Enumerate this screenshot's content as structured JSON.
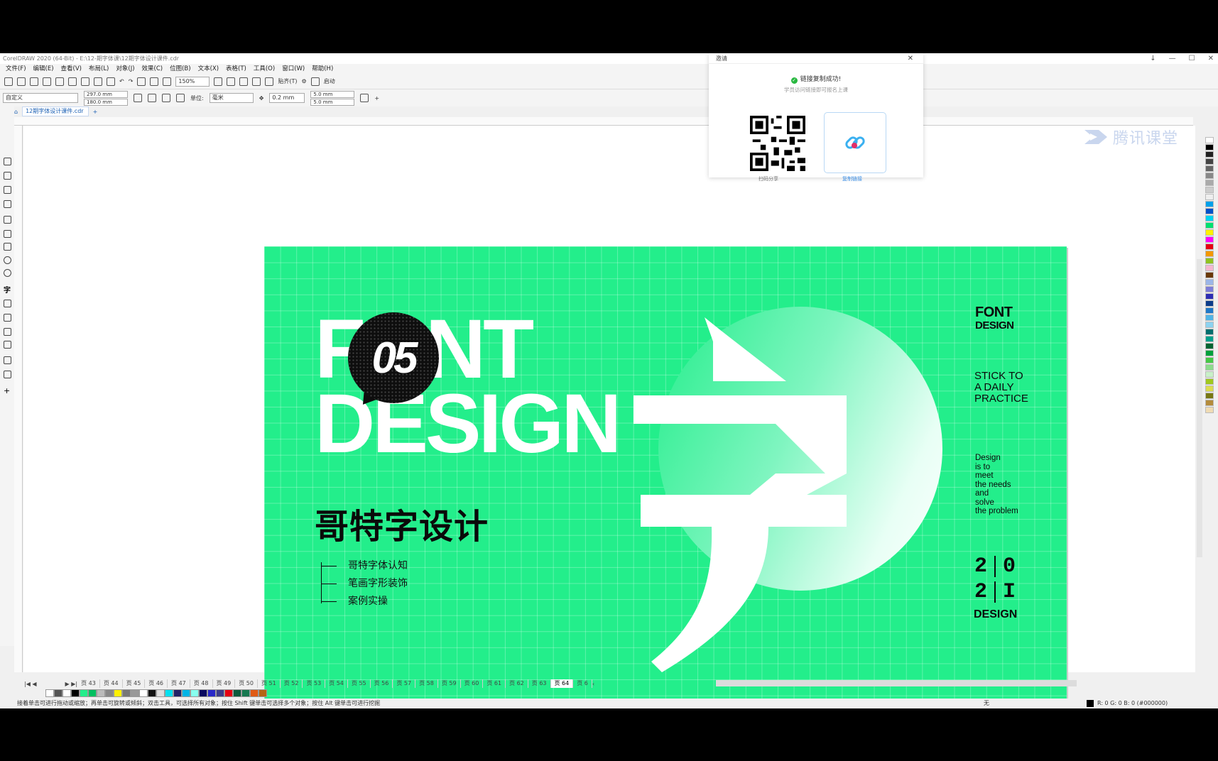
{
  "window": {
    "title": "CorelDRAW 2020 (64-Bit) - E:\\12-期字体课\\12期字体设计课件.cdr",
    "controls": [
      "↓",
      "—",
      "☐",
      "✕"
    ]
  },
  "menu": [
    "文件(F)",
    "编辑(E)",
    "查看(V)",
    "布局(L)",
    "对象(J)",
    "效果(C)",
    "位图(B)",
    "文本(X)",
    "表格(T)",
    "工具(O)",
    "窗口(W)",
    "帮助(H)"
  ],
  "toolbar": {
    "zoom": "150%",
    "snap_label": "贴齐(T)",
    "launch_label": "启动"
  },
  "property_bar": {
    "page_preset": "自定义",
    "width": "297.0 mm",
    "height": "180.0 mm",
    "unit_label": "单位:",
    "unit": "毫米",
    "nudge": "0.2 mm",
    "dup_x": "5.0 mm",
    "dup_y": "5.0 mm"
  },
  "document_tab": "12期字体设计课件.cdr",
  "artwork": {
    "font_word": "FONT",
    "design_word": "DESIGN",
    "badge_number": "05",
    "cn_title": "哥特字设计",
    "outline": [
      "哥特字体认知",
      "笔画字形装饰",
      "案例实操"
    ],
    "side_font_line1": "FONT",
    "side_font_line2": "DESIGN",
    "side_stick": [
      "STICK TO",
      "A DAILY",
      "PRACTICE"
    ],
    "side_design": [
      "Design",
      "is to",
      "meet",
      "the needs",
      "and",
      "solve",
      "the problem"
    ],
    "year_row1": [
      "2",
      "0"
    ],
    "year_row2": [
      "2",
      "I"
    ],
    "year_label": "DESIGN",
    "accent_color": "#23ee8b"
  },
  "share_popup": {
    "title": "邀请",
    "status": "链接复制成功!",
    "subtitle": "学员访问链接即可报名上课",
    "qr_label": "扫码分享",
    "link_label": "复制链接"
  },
  "brand": {
    "name": "腾讯课堂"
  },
  "page_tabs": [
    "页 43",
    "页 44",
    "页 45",
    "页 46",
    "页 47",
    "页 48",
    "页 49",
    "页 50",
    "页 51",
    "页 52",
    "页 53",
    "页 54",
    "页 55",
    "页 56",
    "页 57",
    "页 58",
    "页 59",
    "页 60",
    "页 61",
    "页 62",
    "页 63",
    "页 64",
    "页 6"
  ],
  "active_page": "页 64",
  "status_text": "接着单击可进行拖动或缩放；再单击可旋转或倾斜；双击工具，可选择所有对象；按住 Shift 键单击可选择多个对象；按住 Alt 键单击可进行挖掘",
  "fill_status": "无",
  "color_readout": "R: 0 G: 0 B: 0 (#000000)"
}
